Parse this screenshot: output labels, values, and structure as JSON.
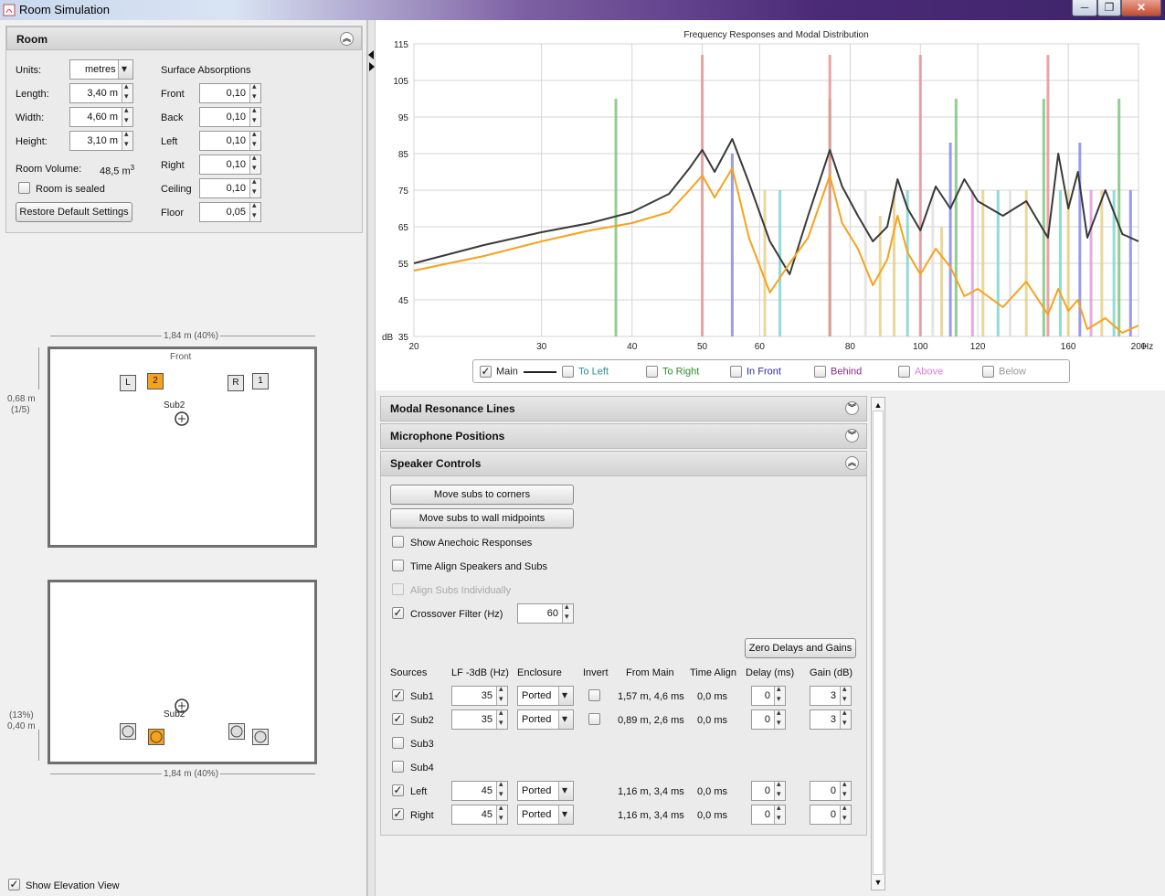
{
  "window": {
    "title": "Room Simulation",
    "buttons": [
      "─",
      "❐",
      "✕"
    ]
  },
  "room": {
    "header": "Room",
    "units_label": "Units:",
    "units_value": "metres",
    "length_label": "Length:",
    "length_value": "3,40 m",
    "width_label": "Width:",
    "width_value": "4,60 m",
    "height_label": "Height:",
    "height_value": "3,10 m",
    "volume_label": "Room Volume:",
    "volume_value": "48,5 m",
    "volume_sup": "3",
    "sealed_label": "Room is sealed",
    "restore_label": "Restore Default Settings",
    "absorptions_header": "Surface Absorptions",
    "surfaces": [
      {
        "label": "Front",
        "value": "0,10"
      },
      {
        "label": "Back",
        "value": "0,10"
      },
      {
        "label": "Left",
        "value": "0,10"
      },
      {
        "label": "Right",
        "value": "0,10"
      },
      {
        "label": "Ceiling",
        "value": "0,10"
      },
      {
        "label": "Floor",
        "value": "0,05"
      }
    ]
  },
  "plan_top": {
    "width_dim": "1,84 m (40%)",
    "front_label": "Front",
    "depth_dim": "0,68 m",
    "depth_frac": "(1/5)",
    "sub_label": "Sub2",
    "speakers": [
      {
        "label": "L"
      },
      {
        "label": "2"
      },
      {
        "label": "R"
      },
      {
        "label": "1"
      }
    ]
  },
  "plan_bottom": {
    "width_dim": "1,84 m (40%)",
    "height_pct": "(13%)",
    "height_dim": "0,40 m",
    "sub_label": "Sub2"
  },
  "elevation_label": "Show Elevation View",
  "chart_data": {
    "type": "line",
    "title": "Frequency Responses and Modal Distribution",
    "xlabel": "Hz",
    "ylabel": "dB",
    "x_scale": "log",
    "xlim": [
      20,
      200
    ],
    "ylim": [
      35,
      115
    ],
    "x_ticks": [
      20,
      30,
      40,
      50,
      60,
      80,
      100,
      120,
      160,
      200
    ],
    "y_ticks": [
      35,
      45,
      55,
      65,
      75,
      85,
      95,
      105,
      115
    ],
    "grid": true,
    "series": [
      {
        "name": "Main",
        "color": "#3a3a3a",
        "x": [
          20,
          25,
          30,
          35,
          40,
          45,
          48,
          50,
          52,
          55,
          58,
          62,
          66,
          70,
          75,
          78,
          82,
          86,
          90,
          93,
          96,
          100,
          105,
          110,
          115,
          120,
          130,
          140,
          150,
          155,
          160,
          165,
          170,
          180,
          190,
          200
        ],
        "y": [
          55,
          60,
          63.5,
          66,
          69,
          74,
          81,
          86,
          80,
          89,
          77,
          61,
          52,
          68,
          86,
          76,
          68,
          61,
          65,
          78,
          70,
          64,
          76,
          70,
          78,
          72,
          68,
          72,
          62,
          85,
          70,
          80,
          62,
          75,
          63,
          61
        ]
      },
      {
        "name": "",
        "color": "#f7a21b",
        "x": [
          20,
          25,
          30,
          35,
          40,
          45,
          48,
          50,
          52,
          55,
          58,
          62,
          66,
          70,
          75,
          78,
          82,
          86,
          90,
          93,
          96,
          100,
          105,
          110,
          115,
          120,
          130,
          140,
          150,
          155,
          160,
          165,
          170,
          180,
          190,
          200
        ],
        "y": [
          53,
          57,
          61,
          64,
          66,
          69,
          75,
          79,
          73,
          81,
          62,
          47,
          55,
          62,
          79,
          66,
          59,
          49,
          56,
          68,
          58,
          52,
          59,
          54,
          46,
          48,
          43,
          50,
          41,
          48,
          42,
          45,
          37,
          40,
          36,
          38
        ]
      }
    ],
    "modal_lines": [
      {
        "x": 38,
        "y": 100,
        "color": "#7fc47f"
      },
      {
        "x": 50,
        "y": 112,
        "color": "#e89494"
      },
      {
        "x": 55,
        "y": 85,
        "color": "#8a8ae6"
      },
      {
        "x": 61,
        "y": 75,
        "color": "#e5d08a"
      },
      {
        "x": 64,
        "y": 75,
        "color": "#7fd6cf"
      },
      {
        "x": 75,
        "y": 100,
        "color": "#7fc47f"
      },
      {
        "x": 75,
        "y": 112,
        "color": "#e89494"
      },
      {
        "x": 84,
        "y": 75,
        "color": "#e1e1e1"
      },
      {
        "x": 88,
        "y": 68,
        "color": "#e5d08a"
      },
      {
        "x": 92,
        "y": 75,
        "color": "#e5d08a"
      },
      {
        "x": 96,
        "y": 75,
        "color": "#7fd6cf"
      },
      {
        "x": 100,
        "y": 112,
        "color": "#e89494"
      },
      {
        "x": 104,
        "y": 75,
        "color": "#e1e1e1"
      },
      {
        "x": 107,
        "y": 65,
        "color": "#e5d08a"
      },
      {
        "x": 110,
        "y": 88,
        "color": "#8a8ae6"
      },
      {
        "x": 112,
        "y": 100,
        "color": "#7fc47f"
      },
      {
        "x": 118,
        "y": 75,
        "color": "#e09be0"
      },
      {
        "x": 122,
        "y": 75,
        "color": "#e5d08a"
      },
      {
        "x": 128,
        "y": 75,
        "color": "#7fd6cf"
      },
      {
        "x": 133,
        "y": 75,
        "color": "#e1e1e1"
      },
      {
        "x": 140,
        "y": 75,
        "color": "#e5d08a"
      },
      {
        "x": 148,
        "y": 100,
        "color": "#7fc47f"
      },
      {
        "x": 150,
        "y": 112,
        "color": "#e89494"
      },
      {
        "x": 156,
        "y": 75,
        "color": "#7fd6cf"
      },
      {
        "x": 160,
        "y": 75,
        "color": "#e5d08a"
      },
      {
        "x": 166,
        "y": 88,
        "color": "#8a8ae6"
      },
      {
        "x": 172,
        "y": 75,
        "color": "#e09be0"
      },
      {
        "x": 178,
        "y": 75,
        "color": "#e5d08a"
      },
      {
        "x": 185,
        "y": 75,
        "color": "#7fd6cf"
      },
      {
        "x": 188,
        "y": 100,
        "color": "#7fc47f"
      },
      {
        "x": 195,
        "y": 75,
        "color": "#8a8ae6"
      }
    ]
  },
  "legend": [
    {
      "label": "Main",
      "checked": true,
      "color": "#222222"
    },
    {
      "label": "To Left",
      "checked": false,
      "color": "#2a8f8f"
    },
    {
      "label": "To Right",
      "checked": false,
      "color": "#2e8b2e"
    },
    {
      "label": "In Front",
      "checked": false,
      "color": "#2b2b9b"
    },
    {
      "label": "Behind",
      "checked": false,
      "color": "#8a2a8a"
    },
    {
      "label": "Above",
      "checked": false,
      "color": "#e07ae0"
    },
    {
      "label": "Below",
      "checked": false,
      "color": "#9a9a9a"
    }
  ],
  "sections": {
    "modal": "Modal Resonance Lines",
    "mic": "Microphone Positions",
    "speaker": "Speaker Controls"
  },
  "speaker_controls": {
    "move_corners": "Move subs to corners",
    "move_midpoints": "Move subs to wall midpoints",
    "show_anechoic": "Show Anechoic Responses",
    "time_align": "Time Align Speakers and Subs",
    "align_subs": "Align Subs Individually",
    "crossover_label": "Crossover Filter (Hz)",
    "crossover_value": "60",
    "zero_delays": "Zero Delays and Gains",
    "headers": [
      "Sources",
      "LF -3dB (Hz)",
      "Enclosure",
      "Invert",
      "From Main",
      "Time Align",
      "Delay (ms)",
      "Gain (dB)"
    ],
    "rows": [
      {
        "name": "Sub1",
        "checked": true,
        "lf": "35",
        "enclosure": "Ported",
        "invert": true,
        "from_main": "1,57 m, 4,6 ms",
        "time_align": "0,0 ms",
        "delay": "0",
        "gain": "3"
      },
      {
        "name": "Sub2",
        "checked": true,
        "lf": "35",
        "enclosure": "Ported",
        "invert": true,
        "from_main": "0,89 m, 2,6 ms",
        "time_align": "0,0 ms",
        "delay": "0",
        "gain": "3"
      },
      {
        "name": "Sub3",
        "checked": false
      },
      {
        "name": "Sub4",
        "checked": false
      },
      {
        "name": "Left",
        "checked": true,
        "lf": "45",
        "enclosure": "Ported",
        "invert": false,
        "from_main": "1,16 m, 3,4 ms",
        "time_align": "0,0 ms",
        "delay": "0",
        "gain": "0"
      },
      {
        "name": "Right",
        "checked": true,
        "lf": "45",
        "enclosure": "Ported",
        "invert": false,
        "from_main": "1,16 m, 3,4 ms",
        "time_align": "0,0 ms",
        "delay": "0",
        "gain": "0"
      }
    ]
  }
}
